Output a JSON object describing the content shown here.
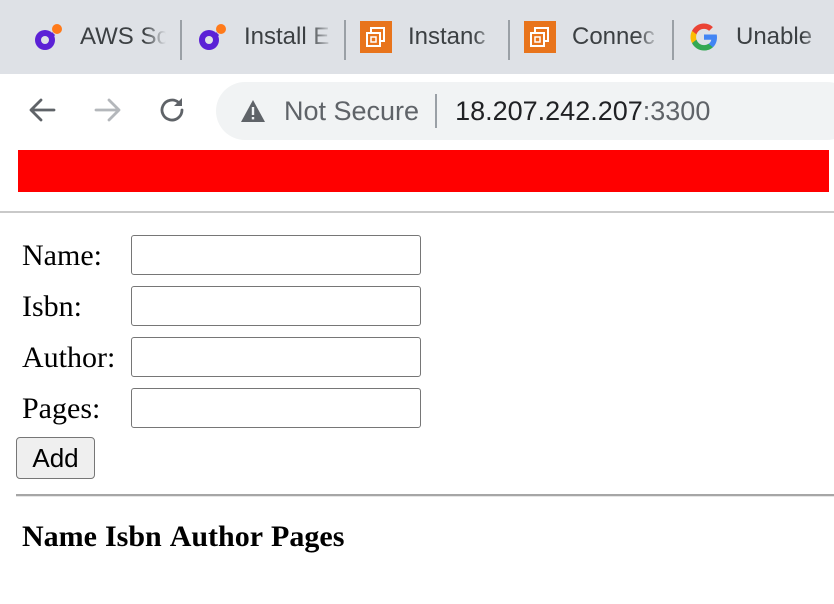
{
  "browser": {
    "tabs": [
      {
        "title": "AWS Sc",
        "icon": "orbit-app-icon"
      },
      {
        "title": "Install E",
        "icon": "orbit-app-icon"
      },
      {
        "title": "Instanc",
        "icon": "aws-ec2-icon"
      },
      {
        "title": "Connec",
        "icon": "aws-ec2-icon"
      },
      {
        "title": "Unable",
        "icon": "google-icon"
      }
    ],
    "address": {
      "security_label": "Not Secure",
      "host": "18.207.242.207",
      "port": ":3300"
    },
    "colors": {
      "tabstrip_bg": "#dee1e6",
      "omnibox_bg": "#f1f3f4",
      "ec2_orange": "#e8741c"
    }
  },
  "page": {
    "banner_color": "#ff0000",
    "form": {
      "fields": [
        {
          "label": "Name:",
          "value": ""
        },
        {
          "label": "Isbn:",
          "value": ""
        },
        {
          "label": "Author:",
          "value": ""
        },
        {
          "label": "Pages:",
          "value": ""
        }
      ],
      "submit_label": "Add"
    },
    "table": {
      "headers": [
        "Name",
        "Isbn",
        "Author",
        "Pages"
      ]
    }
  }
}
